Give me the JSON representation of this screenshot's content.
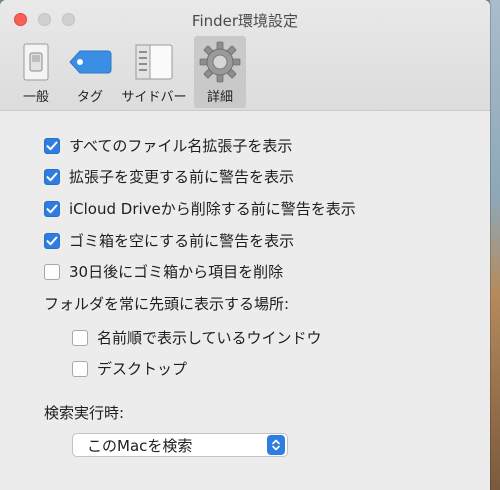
{
  "window": {
    "title": "Finder環境設定"
  },
  "toolbar": {
    "items": [
      {
        "label": "一般",
        "icon": "switch-icon"
      },
      {
        "label": "タグ",
        "icon": "tag-icon"
      },
      {
        "label": "サイドバー",
        "icon": "sidebar-icon"
      },
      {
        "label": "詳細",
        "icon": "gear-icon",
        "selected": true
      }
    ]
  },
  "options": [
    {
      "label": "すべてのファイル名拡張子を表示",
      "checked": true
    },
    {
      "label": "拡張子を変更する前に警告を表示",
      "checked": true
    },
    {
      "label": "iCloud Driveから削除する前に警告を表示",
      "checked": true
    },
    {
      "label": "ゴミ箱を空にする前に警告を表示",
      "checked": true
    },
    {
      "label": "30日後にゴミ箱から項目を削除",
      "checked": false
    }
  ],
  "folders_on_top": {
    "heading": "フォルダを常に先頭に表示する場所:",
    "options": [
      {
        "label": "名前順で表示しているウインドウ",
        "checked": false
      },
      {
        "label": "デスクトップ",
        "checked": false
      }
    ]
  },
  "search": {
    "heading": "検索実行時:",
    "selected": "このMacを検索"
  },
  "colors": {
    "accent": "#2f7de1",
    "close": "#fc5f57"
  }
}
